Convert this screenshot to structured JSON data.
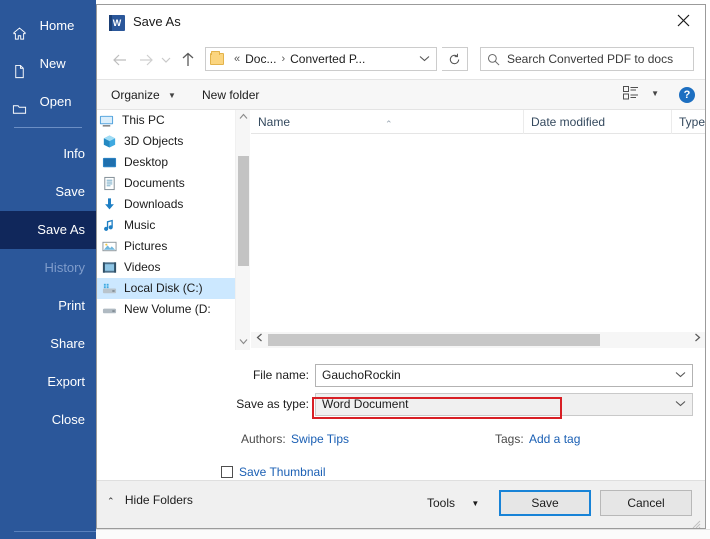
{
  "backstage": {
    "items": [
      {
        "label": "Home",
        "icon": "home-icon",
        "state": "normal"
      },
      {
        "label": "New",
        "icon": "new-document-icon",
        "state": "normal"
      },
      {
        "label": "Open",
        "icon": "open-folder-icon",
        "state": "normal"
      },
      {
        "label": "Info",
        "icon": "",
        "state": "normal"
      },
      {
        "label": "Save",
        "icon": "",
        "state": "normal"
      },
      {
        "label": "Save As",
        "icon": "",
        "state": "selected"
      },
      {
        "label": "History",
        "icon": "",
        "state": "disabled"
      },
      {
        "label": "Print",
        "icon": "",
        "state": "normal"
      },
      {
        "label": "Share",
        "icon": "",
        "state": "normal"
      },
      {
        "label": "Export",
        "icon": "",
        "state": "normal"
      },
      {
        "label": "Close",
        "icon": "",
        "state": "normal"
      }
    ],
    "accent_color": "#2b579a",
    "selected_color": "#10275b"
  },
  "dialog": {
    "title": "Save As",
    "app_icon_letter": "W",
    "close_label": "✕",
    "address": {
      "breadcrumb_prefix": "«",
      "crumbs": [
        "Doc...",
        "Converted P..."
      ],
      "separator": "›",
      "dropdown_caret": "⌄",
      "refresh_icon": "refresh-icon"
    },
    "search": {
      "placeholder": "Search Converted PDF to docs",
      "icon": "search-icon"
    },
    "toolbar": {
      "organize_label": "Organize",
      "new_folder_label": "New folder",
      "caret": "▼",
      "view_icon": "view-options-icon",
      "help_label": "?"
    },
    "nav_pane": {
      "items": [
        {
          "label": "This PC",
          "icon": "this-pc-icon",
          "indent": false,
          "selected": false
        },
        {
          "label": "3D Objects",
          "icon": "3d-objects-icon",
          "indent": true,
          "selected": false
        },
        {
          "label": "Desktop",
          "icon": "desktop-icon",
          "indent": true,
          "selected": false
        },
        {
          "label": "Documents",
          "icon": "documents-icon",
          "indent": true,
          "selected": false
        },
        {
          "label": "Downloads",
          "icon": "downloads-icon",
          "indent": true,
          "selected": false
        },
        {
          "label": "Music",
          "icon": "music-icon",
          "indent": true,
          "selected": false
        },
        {
          "label": "Pictures",
          "icon": "pictures-icon",
          "indent": true,
          "selected": false
        },
        {
          "label": "Videos",
          "icon": "videos-icon",
          "indent": true,
          "selected": false
        },
        {
          "label": "Local Disk (C:)",
          "icon": "local-disk-icon",
          "indent": true,
          "selected": true
        },
        {
          "label": "New Volume (D:",
          "icon": "new-volume-icon",
          "indent": true,
          "selected": false
        }
      ]
    },
    "file_list": {
      "columns": [
        "Name",
        "Date modified",
        "Type"
      ],
      "sort_column": "Name",
      "sort_caret": "⌃",
      "rows": []
    },
    "form": {
      "file_name_label": "File name:",
      "file_name_value": "GauchoRockin",
      "save_as_type_label": "Save as type:",
      "save_as_type_value": "Word Document",
      "combo_caret": "⌄",
      "authors_label": "Authors:",
      "authors_value": "Swipe Tips",
      "tags_label": "Tags:",
      "tags_value": "Add a tag",
      "save_thumbnail_label": "Save Thumbnail",
      "save_thumbnail_checked": false,
      "highlight_color": "#d81f25"
    },
    "footer": {
      "hide_folders_label": "Hide Folders",
      "hide_folders_caret": "⌃",
      "tools_label": "Tools",
      "tools_caret": "▼",
      "save_label": "Save",
      "cancel_label": "Cancel",
      "focus_color": "#1883d7"
    }
  }
}
